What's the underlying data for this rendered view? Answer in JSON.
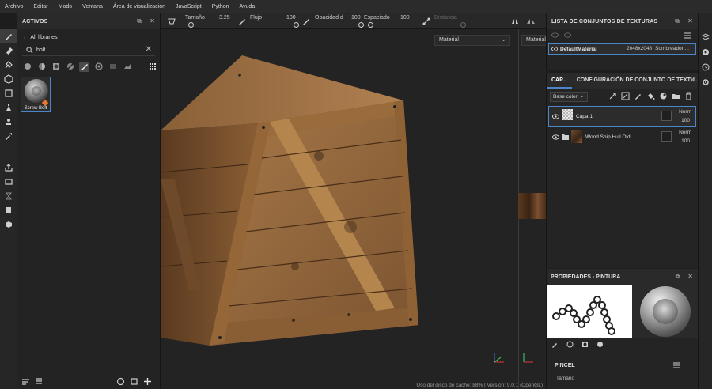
{
  "menu": [
    "Archivo",
    "Editar",
    "Modo",
    "Ventana",
    "Área de visualización",
    "JavaScript",
    "Python",
    "Ayuda"
  ],
  "toolbar": {
    "size_label": "Tamaño",
    "size_value": "3.25",
    "size_level": 0.12,
    "flow_label": "Flujo",
    "flow_value": "100",
    "flow_level": 1.0,
    "opacity_label": "Opacidad d",
    "opacity_value": "100",
    "opacity_level": 1.0,
    "spacing_label": "Espaciado",
    "spacing_value": "100",
    "spacing_level": 0.15,
    "distance_label": "Distancia",
    "distance_level": 0.6
  },
  "assets": {
    "title": "ACTIVOS",
    "library": "All libraries",
    "search_value": "bolt",
    "items": [
      {
        "label": "Screw Bolt",
        "icon": "screw-bolt-thumbnail"
      }
    ]
  },
  "viewport": {
    "left_mode": "Material",
    "status": "Uso del disco de caché: 88% | Versión: 9.0.1 (OpenGL)"
  },
  "texture_sets": {
    "title": "LISTA DE CONJUNTOS DE TEXTURAS",
    "row": {
      "name": "DefaultMaterial",
      "resolution": "2048x2048",
      "shader": "Sombreador ..."
    }
  },
  "layers": {
    "tab_layers": "CAP...",
    "tab_config": "CONFIGURACIÓN DE CONJUNTO DE TEXTU...",
    "channel": "Base color",
    "items": [
      {
        "name": "Capa 1",
        "blend": "Norm",
        "opacity": "100"
      },
      {
        "name": "Wood Ship Hull Old",
        "blend": "Norm",
        "opacity": "100"
      }
    ]
  },
  "properties": {
    "title": "PROPIEDADES - PINTURA",
    "section": "PINCEL",
    "size_label": "Tamaño"
  },
  "colors": {
    "accent": "#4a86c8",
    "wood": "#8a5a30",
    "tag": "#e8792e"
  }
}
